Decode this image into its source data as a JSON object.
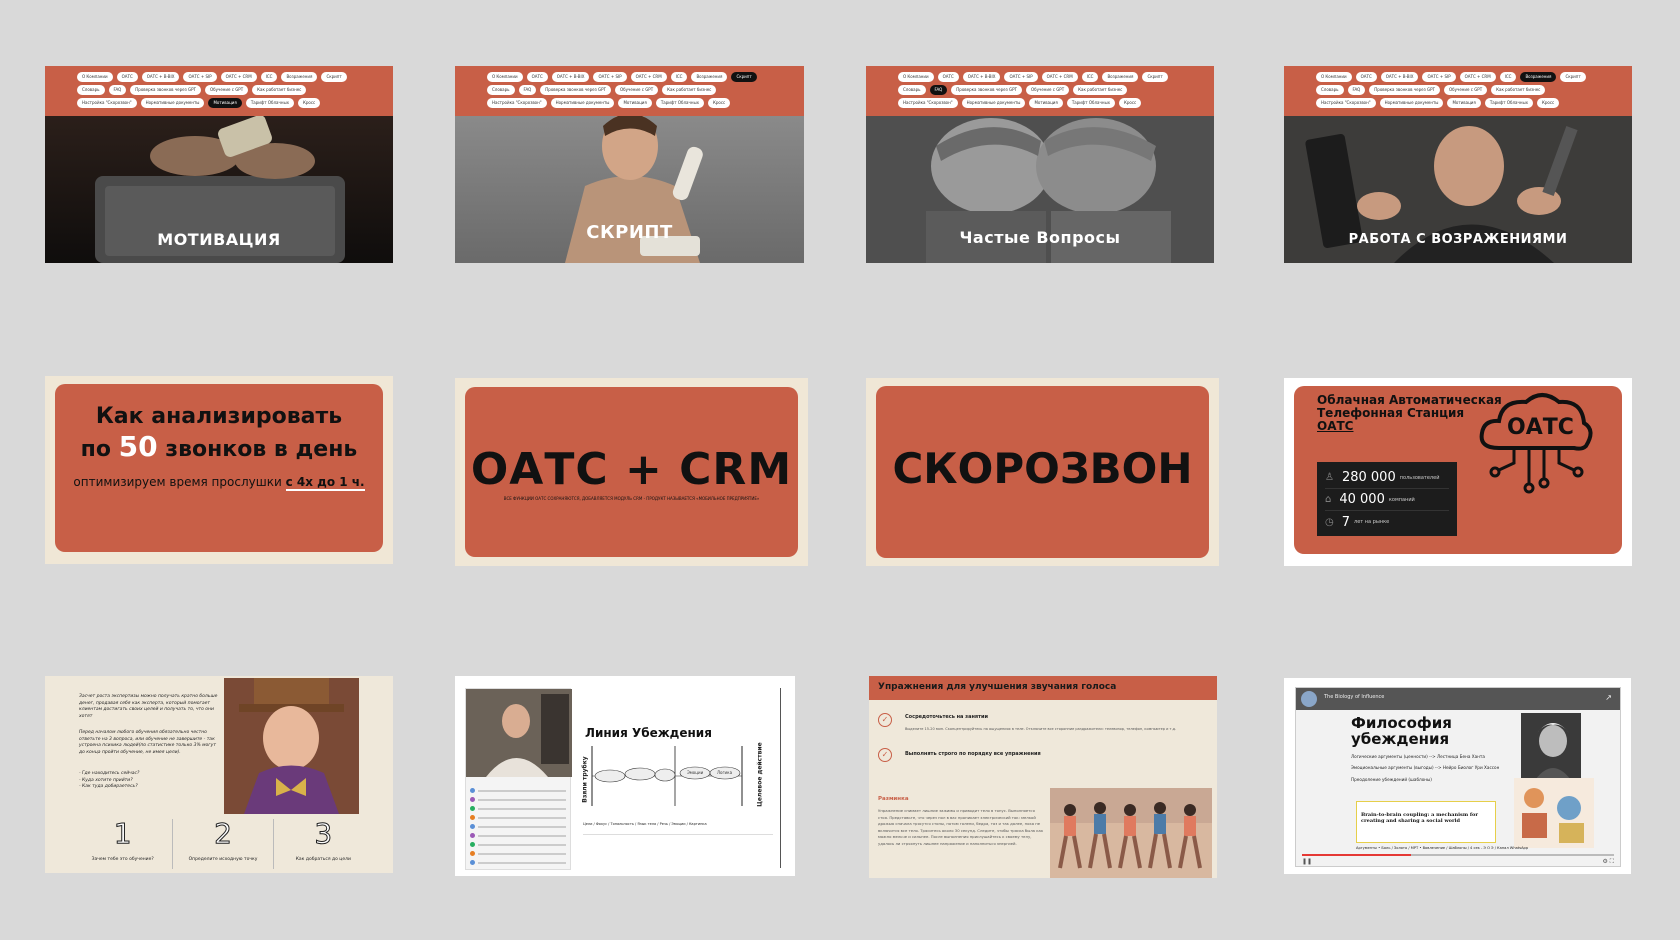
{
  "nav_pills": [
    "О Компании",
    "ОАТС",
    "ОАТС + B-BIX",
    "ОАТС + SIP",
    "ОАТС + CRM",
    "ICC",
    "Возражения",
    "Скрипт",
    "Словарь",
    "FAQ",
    "Проверка звонков через GPT",
    "Обучение с GPT",
    "Как работает бизнес",
    "Настройка \"Скорозвон\"",
    "Нормативные документы",
    "Мотивация",
    "Тарифт Облачных",
    "Кросс"
  ],
  "row1": {
    "motivation": {
      "caption": "МОТИВАЦИЯ"
    },
    "script": {
      "caption": "СКРИПТ"
    },
    "faq": {
      "caption": "Частые Вопросы"
    },
    "objections": {
      "caption": "РАБОТА С ВОЗРАЖЕНИЯМИ"
    }
  },
  "row2": {
    "analyze": {
      "line1": "Как анализировать",
      "line2_pre": "по ",
      "line2_num": "50",
      "line2_post": " звонков в день",
      "sub_pre": "оптимизируем время прослушки ",
      "sub_em": "с 4х до 1 ч."
    },
    "oats_crm": {
      "title": "ОАТС + CRM",
      "sub": "ВСЕ ФУНКЦИИ ОАТС СОХРАНЯЮТСЯ, ДОБАВЛЯЕТСЯ МОДУЛЬ CRM - ПРОДУКТ НАЗЫВАЕТСЯ «МОБИЛЬНОЕ ПРЕДПРИЯТИЕ»"
    },
    "skorozvon": {
      "title": "СКОРОЗВОН"
    },
    "oats": {
      "line1": "Облачная Автоматическая",
      "line2": "Телефонная Станция",
      "link": "ОАТС",
      "cloud_label": "ОАТС",
      "stats": [
        {
          "value": "280 000",
          "label": "пользователей"
        },
        {
          "value": "40 000",
          "label": "компаний"
        },
        {
          "value": "7",
          "label": "лет на рынке"
        }
      ]
    }
  },
  "row3": {
    "training": {
      "p1": "Засчет роста экспертизы можно получать кратно больше денег, продавая себя как эксперта, который помогает клиентам достигать своих целей и получать то, что они хотят",
      "p2": "Перед началом любого обучения обязательно честно ответьте на 3 вопроса, или обучение не завершите - так устроена психика людей(по статистике только 3% могут до конца пройти обучение, не имея цели).",
      "questions": [
        "- Где находитесь сейчас?",
        "- Куда хотите прийти?",
        "- Как туда добираетесь?"
      ],
      "steps": [
        {
          "num": "1",
          "label": "Зачем тебе это обучение?"
        },
        {
          "num": "2",
          "label": "Определите исходную точку"
        },
        {
          "num": "3",
          "label": "Как добраться до цели"
        }
      ]
    },
    "persuasion": {
      "title": "Линия Убеждения",
      "left_axis": "Взяли трубку",
      "right_axis": "Целевое действие",
      "clouds": [
        "",
        "",
        "",
        "Эмоции",
        "Логика"
      ],
      "footer": "Цели / Фокус / Тональность / Язык тела / Речь / Эмоции / Картинка"
    },
    "voice": {
      "header": "Упражнения для улучшения звучания голоса",
      "item1": "Сосредоточьтесь на занятии",
      "item1_sub": "Выделите 15-20 мин. Сконцентрируйтесь на ощущениях в теле. Отключите все сторонние раздражители: телевизор, телефон, компьютер и т.д.",
      "item2": "Выполнять строго по порядку все упражнения",
      "section": "Разминка",
      "body": "Упражнение снимает лишние зажимы и приводит тело в тонус. Выполняется стоя. Представьте, что через пол в вас проникает электрический ток: мелкой дрожью сначала трясутся стопы, потом голени, бедра, таз и так далее, пока не включится все тело. Тряситесь около 30 секунд. Следите, чтобы тряска была как можно мельче и сильнее. После выполнения прислушайтесь к своему телу, удалось ли стряхнуть лишнее напряжение и наполниться энергией."
    },
    "philosophy": {
      "title_line1": "Философия",
      "title_line2": "убеждения",
      "line1": "Логические аргументы (ценности) --> Лестница Бена Ханта",
      "line2": "Эмоциональные аргументы (выгоды) --> Нейро Биолог Ури Хассон",
      "line3": "Преодоление убеждений (шаблоны)",
      "paper_title": "Brain-to-brain coupling: a mechanism for creating and sharing a social world",
      "footer": "Аргументы • Боль / Золото / МРТ • Вовлечение / Шаблоны / 4 сек - Э О Э / Канал WhatsApp",
      "video_title": "The Biology of Influence"
    }
  }
}
